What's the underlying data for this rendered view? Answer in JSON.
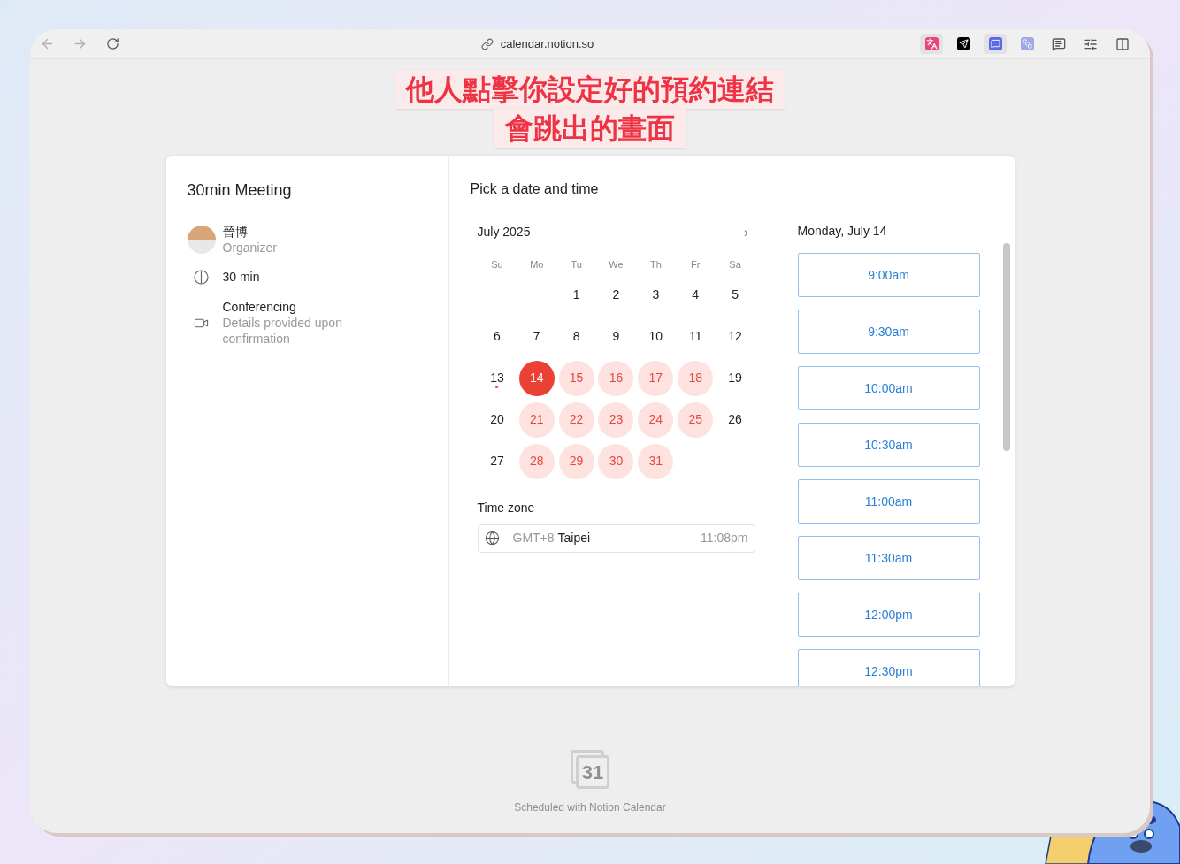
{
  "browser": {
    "url": "calendar.notion.so"
  },
  "annotation": {
    "lines": [
      "他人點擊你設定好的預約連結",
      "會跳出的畫面"
    ]
  },
  "event": {
    "title": "30min Meeting",
    "organizer": {
      "name": "晉博",
      "role": "Organizer"
    },
    "duration": "30 min",
    "conferencing": {
      "label": "Conferencing",
      "detail": "Details provided upon confirmation"
    }
  },
  "picker": {
    "heading": "Pick a date and time",
    "month": "July 2025",
    "next": "›",
    "weekdays": [
      "Su",
      "Mo",
      "Tu",
      "We",
      "Th",
      "Fr",
      "Sa"
    ],
    "weeks": [
      [
        {
          "kind": "blank"
        },
        {
          "kind": "blank"
        },
        {
          "kind": "day",
          "label": "1",
          "available": false,
          "selected": false,
          "today": false
        },
        {
          "kind": "day",
          "label": "2",
          "available": false,
          "selected": false,
          "today": false
        },
        {
          "kind": "day",
          "label": "3",
          "available": false,
          "selected": false,
          "today": false
        },
        {
          "kind": "day",
          "label": "4",
          "available": false,
          "selected": false,
          "today": false
        },
        {
          "kind": "day",
          "label": "5",
          "available": false,
          "selected": false,
          "today": false
        }
      ],
      [
        {
          "kind": "day",
          "label": "6",
          "available": false,
          "selected": false,
          "today": false
        },
        {
          "kind": "day",
          "label": "7",
          "available": false,
          "selected": false,
          "today": false
        },
        {
          "kind": "day",
          "label": "8",
          "available": false,
          "selected": false,
          "today": false
        },
        {
          "kind": "day",
          "label": "9",
          "available": false,
          "selected": false,
          "today": false
        },
        {
          "kind": "day",
          "label": "10",
          "available": false,
          "selected": false,
          "today": false
        },
        {
          "kind": "day",
          "label": "11",
          "available": false,
          "selected": false,
          "today": false
        },
        {
          "kind": "day",
          "label": "12",
          "available": false,
          "selected": false,
          "today": false
        }
      ],
      [
        {
          "kind": "day",
          "label": "13",
          "available": false,
          "selected": false,
          "today": true
        },
        {
          "kind": "day",
          "label": "14",
          "available": true,
          "selected": true,
          "today": false
        },
        {
          "kind": "day",
          "label": "15",
          "available": true,
          "selected": false,
          "today": false
        },
        {
          "kind": "day",
          "label": "16",
          "available": true,
          "selected": false,
          "today": false
        },
        {
          "kind": "day",
          "label": "17",
          "available": true,
          "selected": false,
          "today": false
        },
        {
          "kind": "day",
          "label": "18",
          "available": true,
          "selected": false,
          "today": false
        },
        {
          "kind": "day",
          "label": "19",
          "available": false,
          "selected": false,
          "today": false
        }
      ],
      [
        {
          "kind": "day",
          "label": "20",
          "available": false,
          "selected": false,
          "today": false
        },
        {
          "kind": "day",
          "label": "21",
          "available": true,
          "selected": false,
          "today": false
        },
        {
          "kind": "day",
          "label": "22",
          "available": true,
          "selected": false,
          "today": false
        },
        {
          "kind": "day",
          "label": "23",
          "available": true,
          "selected": false,
          "today": false
        },
        {
          "kind": "day",
          "label": "24",
          "available": true,
          "selected": false,
          "today": false
        },
        {
          "kind": "day",
          "label": "25",
          "available": true,
          "selected": false,
          "today": false
        },
        {
          "kind": "day",
          "label": "26",
          "available": false,
          "selected": false,
          "today": false
        }
      ],
      [
        {
          "kind": "day",
          "label": "27",
          "available": false,
          "selected": false,
          "today": false
        },
        {
          "kind": "day",
          "label": "28",
          "available": true,
          "selected": false,
          "today": false
        },
        {
          "kind": "day",
          "label": "29",
          "available": true,
          "selected": false,
          "today": false
        },
        {
          "kind": "day",
          "label": "30",
          "available": true,
          "selected": false,
          "today": false
        },
        {
          "kind": "day",
          "label": "31",
          "available": true,
          "selected": false,
          "today": false
        }
      ]
    ],
    "timezone": {
      "label": "Time zone",
      "offset": "GMT+8",
      "city": "Taipei",
      "time": "11:08pm"
    }
  },
  "slots": {
    "date": "Monday, July 14",
    "times": [
      "9:00am",
      "9:30am",
      "10:00am",
      "10:30am",
      "11:00am",
      "11:30am",
      "12:00pm",
      "12:30pm"
    ]
  },
  "footer": {
    "logo": "31",
    "text": "Scheduled with Notion Calendar"
  }
}
